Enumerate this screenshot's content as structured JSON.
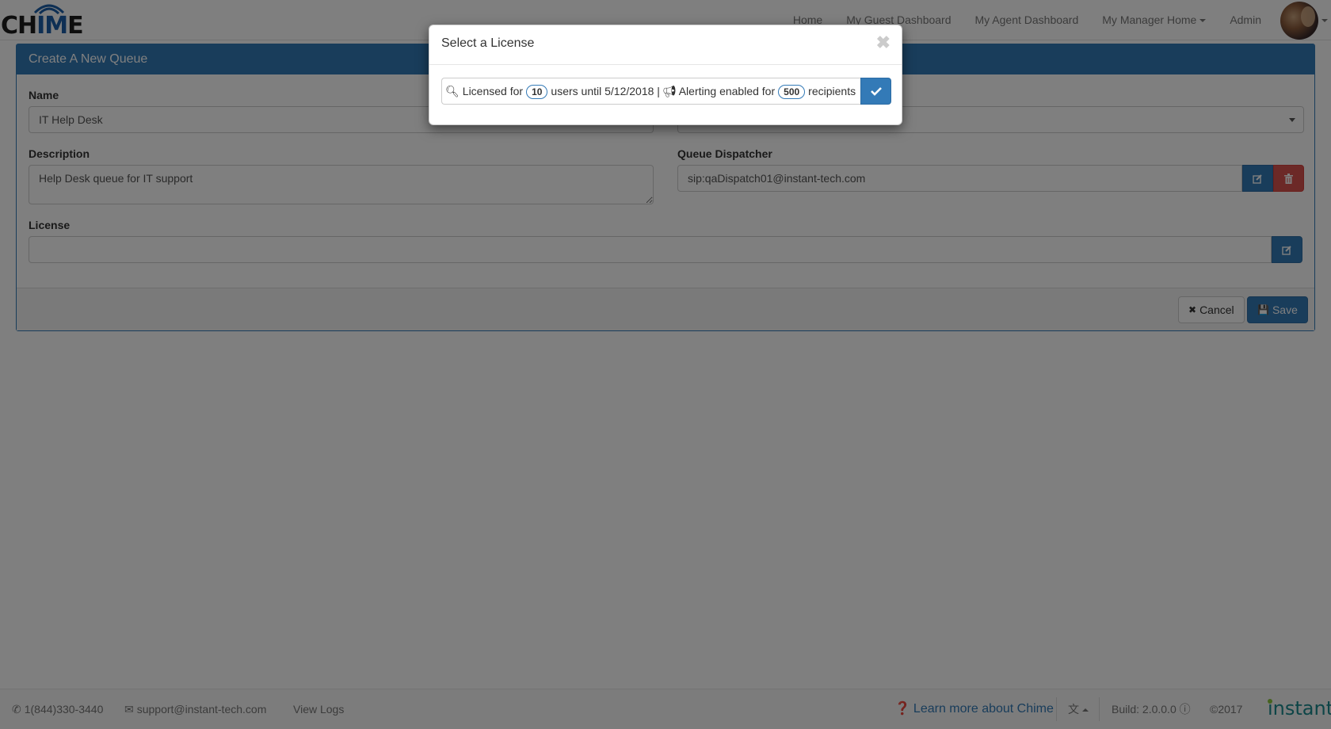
{
  "app": {
    "logo_text_left": "CH",
    "logo_text_mid": "IM",
    "logo_text_right": "E"
  },
  "nav": {
    "items": [
      {
        "label": "Home"
      },
      {
        "label": "My Guest Dashboard"
      },
      {
        "label": "My Agent Dashboard"
      },
      {
        "label": "My Manager Home"
      },
      {
        "label": "Admin"
      }
    ]
  },
  "form": {
    "title": "Create A New Queue",
    "name_label": "Name",
    "name_value": "IT Help Desk",
    "description_label": "Description",
    "description_value": "Help Desk queue for IT support",
    "dispatcher_label": "Queue Dispatcher",
    "dispatcher_value": "sip:qaDispatch01@instant-tech.com",
    "license_label": "License",
    "license_value": "",
    "cancel_label": "Cancel",
    "save_label": "Save"
  },
  "modal": {
    "title": "Select a License",
    "close_glyph": "✖",
    "licensed_for": "Licensed for",
    "users_count": "10",
    "users_until": "users until 5/12/2018 |",
    "alerting_enabled_for": "Alerting enabled for",
    "recipients_count": "500",
    "recipients": "recipients"
  },
  "footer": {
    "phone": "1(844)330-3440",
    "email": "support@instant-tech.com",
    "view_logs": "View Logs",
    "learn_more": "Learn more about Chime",
    "build": "Build: 2.0.0.0",
    "copyright": "©2017",
    "brand": "instant"
  },
  "colors": {
    "primary": "#337ab7",
    "danger": "#d9534f",
    "brand_teal": "#1a8a8f",
    "brand_green": "#8dc63f"
  },
  "icons": [
    "key-icon",
    "bullhorn-icon",
    "check-icon",
    "edit-icon",
    "trash-icon",
    "remove-icon",
    "floppy-icon",
    "phone-icon",
    "envelope-icon",
    "question-circle-icon",
    "info-circle-icon",
    "language-icon"
  ]
}
